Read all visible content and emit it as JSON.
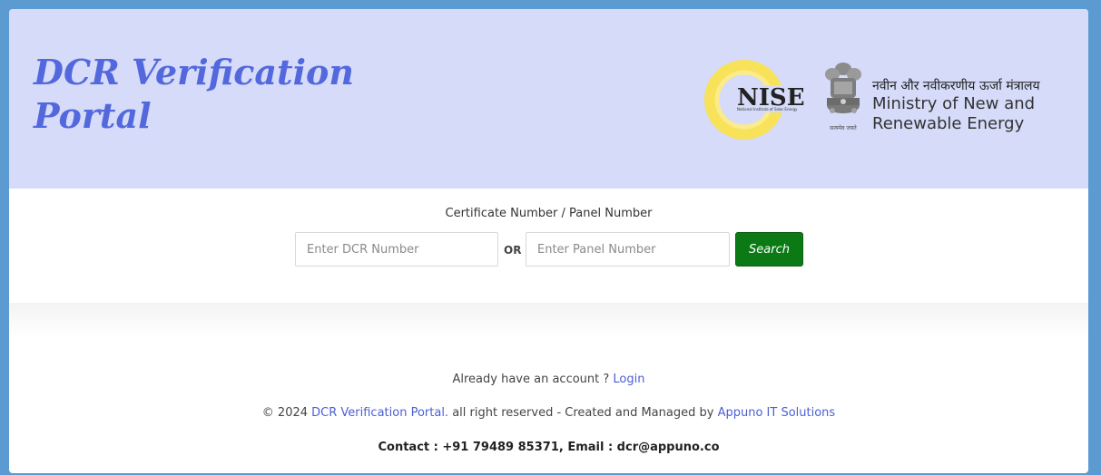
{
  "header": {
    "title_line1": "DCR Verification",
    "title_line2": "Portal",
    "nise_text": "NISE",
    "nise_subtext": "National Institute of Solar Energy",
    "emblem_caption": "सत्यमेव जयते",
    "ministry_hindi": "नवीन और नवीकरणीय ऊर्जा मंत्रालय",
    "ministry_en_line1": "Ministry of New and",
    "ministry_en_line2": "Renewable Energy"
  },
  "search": {
    "label": "Certificate Number / Panel Number",
    "dcr_placeholder": "Enter DCR Number",
    "or_text": "OR",
    "panel_placeholder": "Enter Panel Number",
    "button_label": "Search"
  },
  "footer": {
    "account_text": "Already have an account ?",
    "login_link": "Login",
    "copyright_prefix": "© 2024",
    "portal_link": "DCR Verification Portal.",
    "rights_text": "all right reserved - Created and Managed by",
    "company_link": "Appuno IT Solutions",
    "contact_text": "Contact : +91 79489 85371, Email : dcr@appuno.co"
  },
  "colors": {
    "header_bg": "#d5dbf8",
    "title": "#5468de",
    "search_button": "#0b7a14",
    "link": "#4b5fd6",
    "page_bg": "#5b9bd1"
  }
}
